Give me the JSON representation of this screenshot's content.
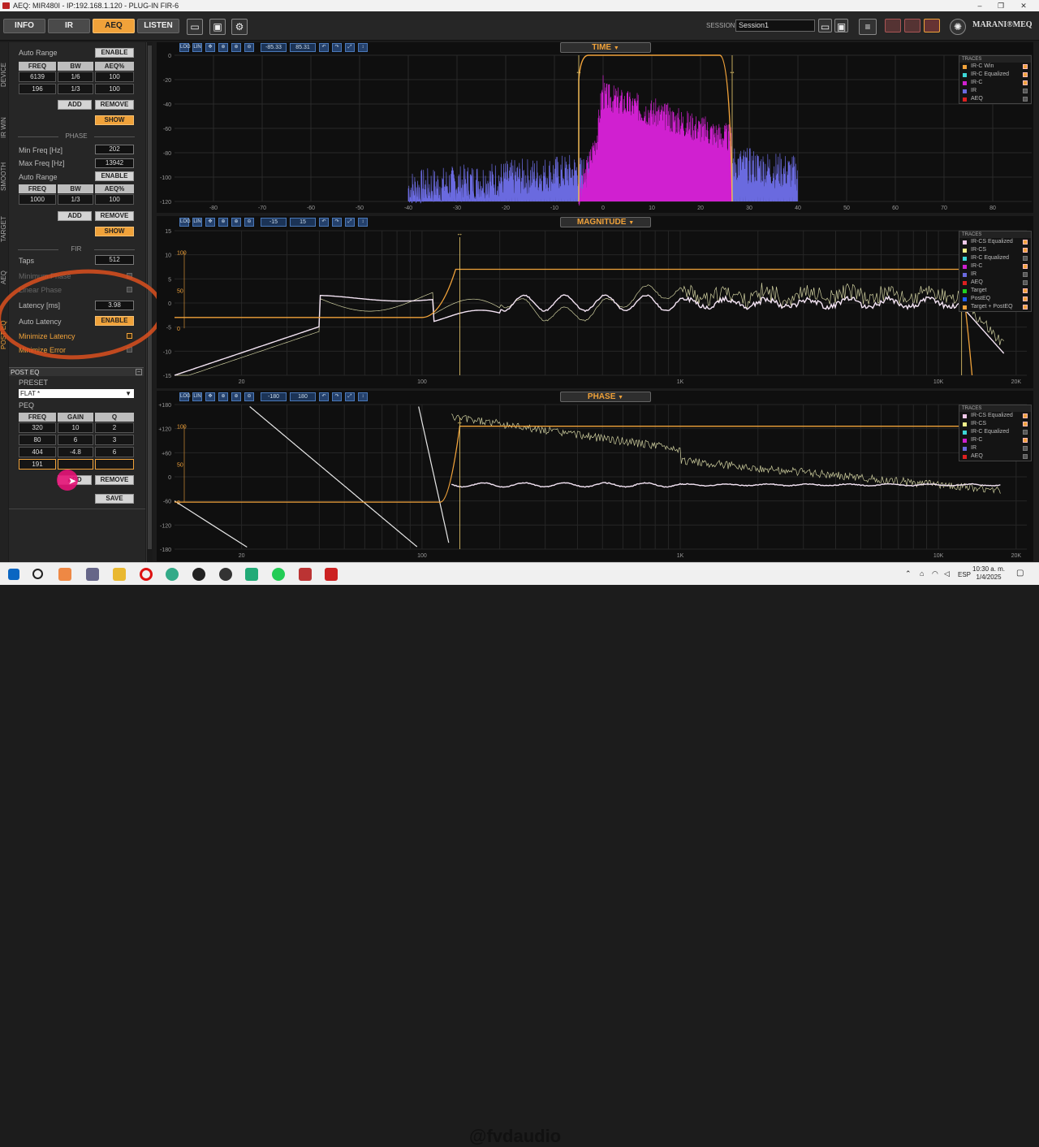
{
  "window": {
    "title": "AEQ: MIR480I - IP:192.168.1.120 - PLUG-IN FIR-6"
  },
  "tabs": [
    {
      "label": "INFO"
    },
    {
      "label": "IR"
    },
    {
      "label": "AEQ"
    },
    {
      "label": "LISTEN"
    }
  ],
  "session": {
    "label": "SESSION",
    "value": "Session1"
  },
  "brand": "MARANI®MEQ",
  "sidetabs": [
    "DEVICE",
    "IR WIN",
    "SMOOTH",
    "TARGET",
    "AEQ",
    "POST EQ"
  ],
  "magnitude_section": {
    "auto_range": "Auto Range",
    "enable": "ENABLE",
    "headers": [
      "FREQ",
      "BW",
      "AEQ%"
    ],
    "rows": [
      [
        "6139",
        "1/6",
        "100"
      ],
      [
        "196",
        "1/3",
        "100"
      ]
    ],
    "add": "ADD",
    "remove": "REMOVE",
    "show": "SHOW"
  },
  "phase_section": {
    "title": "PHASE",
    "min_freq_label": "Min Freq [Hz]",
    "min_freq": "202",
    "max_freq_label": "Max Freq [Hz]",
    "max_freq": "13942",
    "auto_range": "Auto Range",
    "enable": "ENABLE",
    "headers": [
      "FREQ",
      "BW",
      "AEQ%"
    ],
    "rows": [
      [
        "1000",
        "1/3",
        "100"
      ]
    ],
    "add": "ADD",
    "remove": "REMOVE",
    "show": "SHOW"
  },
  "fir_section": {
    "title": "FIR",
    "taps_label": "Taps",
    "taps": "512",
    "min_phase": "Minimum Phase",
    "linear_phase": "Linear Phase",
    "latency_label": "Latency [ms]",
    "latency": "3.98",
    "auto_latency": "Auto Latency",
    "enable": "ENABLE",
    "min_latency": "Minimize Latency",
    "min_error": "Minimize Error"
  },
  "post_eq": {
    "title": "POST EQ",
    "preset_label": "PRESET",
    "preset": "FLAT *",
    "peq_label": "PEQ",
    "headers": [
      "FREQ",
      "GAIN",
      "Q"
    ],
    "rows": [
      [
        "320",
        "10",
        "2"
      ],
      [
        "80",
        "6",
        "3"
      ],
      [
        "404",
        "-4.8",
        "6"
      ],
      [
        "191",
        "",
        ""
      ]
    ],
    "add": "ADD",
    "remove": "REMOVE",
    "save": "SAVE"
  },
  "panels": {
    "time": {
      "title": "TIME",
      "range": [
        "-85.33",
        "85.31"
      ],
      "yticks": [
        "0",
        "-20",
        "-40",
        "-60",
        "-80",
        "-100",
        "-120"
      ],
      "xticks": [
        "-80",
        "-70",
        "-60",
        "-50",
        "-40",
        "-30",
        "-20",
        "-10",
        "0",
        "10",
        "20",
        "30",
        "40",
        "50",
        "60",
        "70",
        "80"
      ]
    },
    "magnitude": {
      "title": "MAGNITUDE",
      "range": [
        "-15",
        "15"
      ],
      "yticks": [
        "15",
        "10",
        "5",
        "0",
        "-5",
        "-10",
        "-15"
      ],
      "xticks": [
        "20",
        "100",
        "1K",
        "10K",
        "20K"
      ],
      "inner": [
        "100",
        "50",
        "0"
      ]
    },
    "phase": {
      "title": "PHASE",
      "range": [
        "-180",
        "180"
      ],
      "yticks": [
        "+180",
        "+120",
        "+60",
        "0",
        "-60",
        "-120",
        "-180"
      ],
      "xticks": [
        "20",
        "100",
        "1K",
        "10K",
        "20K"
      ],
      "inner": [
        "100",
        "50",
        "0"
      ]
    }
  },
  "legend_common": {
    "title": "TRACES"
  },
  "legends": {
    "time": [
      {
        "name": "IR-C Win",
        "color": "#f0a23a"
      },
      {
        "name": "IR-C Equalized",
        "color": "#3cd7d7"
      },
      {
        "name": "IR-C",
        "color": "#d020d0"
      },
      {
        "name": "IR",
        "color": "#6a6adf"
      },
      {
        "name": "AEQ",
        "color": "#dd2020"
      }
    ],
    "magnitude": [
      {
        "name": "IR-CS Equalized",
        "color": "#f0c8e8"
      },
      {
        "name": "IR-CS",
        "color": "#f0f08a"
      },
      {
        "name": "IR-C Equalized",
        "color": "#3cd7d7"
      },
      {
        "name": "IR-C",
        "color": "#d020d0"
      },
      {
        "name": "IR",
        "color": "#6a6adf"
      },
      {
        "name": "AEQ",
        "color": "#dd2020"
      },
      {
        "name": "Target",
        "color": "#20d020"
      },
      {
        "name": "PostEQ",
        "color": "#2060ff"
      },
      {
        "name": "Target + PostEQ",
        "color": "#f0a23a"
      }
    ],
    "phase": [
      {
        "name": "IR-CS Equalized",
        "color": "#f0c8e8"
      },
      {
        "name": "IR-CS",
        "color": "#f0f08a"
      },
      {
        "name": "IR-C Equalized",
        "color": "#3cd7d7"
      },
      {
        "name": "IR-C",
        "color": "#d020d0"
      },
      {
        "name": "IR",
        "color": "#6a6adf"
      },
      {
        "name": "AEQ",
        "color": "#dd2020"
      }
    ]
  },
  "watermark": "@fvdaudio",
  "taskbar": {
    "lang": "ESP",
    "time": "10:30 a. m.",
    "date": "1/4/2025"
  }
}
